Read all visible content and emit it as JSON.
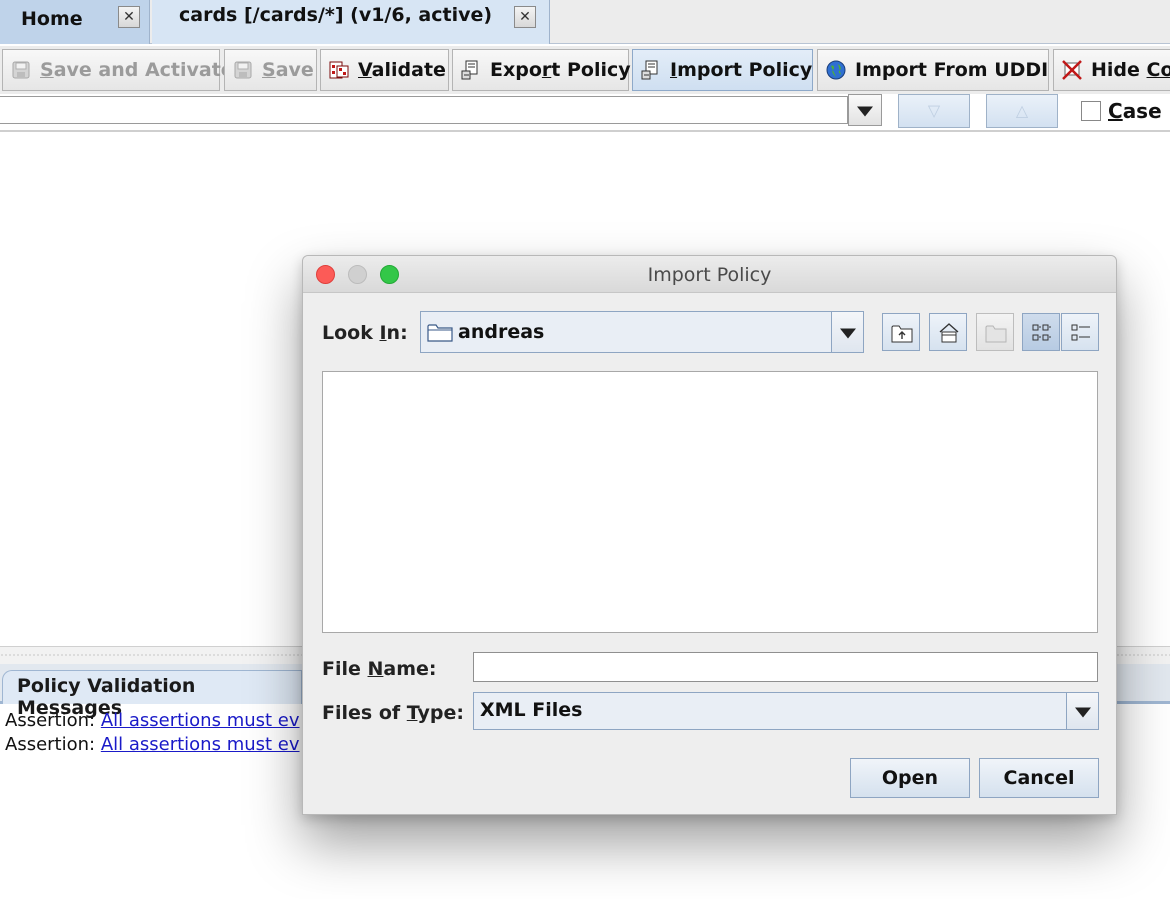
{
  "tabs": [
    {
      "label": "Home"
    },
    {
      "label": "cards [/cards/*] (v1/6, active)"
    }
  ],
  "toolbar": {
    "save_activate": {
      "pre": "",
      "mn": "S",
      "post": "ave and Activate"
    },
    "save": {
      "pre": "",
      "mn": "S",
      "post": "ave"
    },
    "validate": {
      "pre": "",
      "mn": "V",
      "post": "alidate"
    },
    "export": {
      "pre": "Expo",
      "mn": "r",
      "post": "t Policy"
    },
    "import": {
      "pre": "",
      "mn": "I",
      "post": "mport Policy"
    },
    "import_uddi": {
      "pre": "Import From UDDI",
      "mn": "",
      "post": ""
    },
    "hide": {
      "pre": "Hide ",
      "mn": "Co",
      "post": ""
    }
  },
  "search": {
    "value": "",
    "case_label_mn": "C",
    "case_label_rest": "ase S"
  },
  "bottom_panel": {
    "tab_label": "Policy Validation Messages",
    "messages": [
      {
        "prefix": "Assertion: ",
        "link": "All assertions must ev"
      },
      {
        "prefix": "Assertion: ",
        "link": "All assertions must ev"
      }
    ]
  },
  "dialog": {
    "title": "Import Policy",
    "look_in_pre": "Look ",
    "look_in_mn": "I",
    "look_in_post": "n:",
    "look_in_value": "andreas",
    "file_name_pre": "File ",
    "file_name_mn": "N",
    "file_name_post": "ame:",
    "file_name_value": "",
    "files_type_pre": "Files of ",
    "files_type_mn": "T",
    "files_type_post": "ype:",
    "files_type_value": "XML Files",
    "open_label": "Open",
    "cancel_label": "Cancel"
  },
  "icons": {
    "save": "floppy-disk-icon",
    "validate": "validate-icon",
    "export": "export-policy-icon",
    "import": "import-policy-icon",
    "uddi": "globe-icon",
    "hide": "hide-comments-icon",
    "up_folder": "up-one-level-icon",
    "home": "home-folder-icon",
    "new_folder": "new-folder-icon",
    "list_view": "list-view-icon",
    "details_view": "details-view-icon"
  },
  "colors": {
    "link": "#1a1ac8",
    "close_red": "#fc5b57",
    "zoom_green": "#33c748",
    "tab_active": "#d7e5f4"
  }
}
